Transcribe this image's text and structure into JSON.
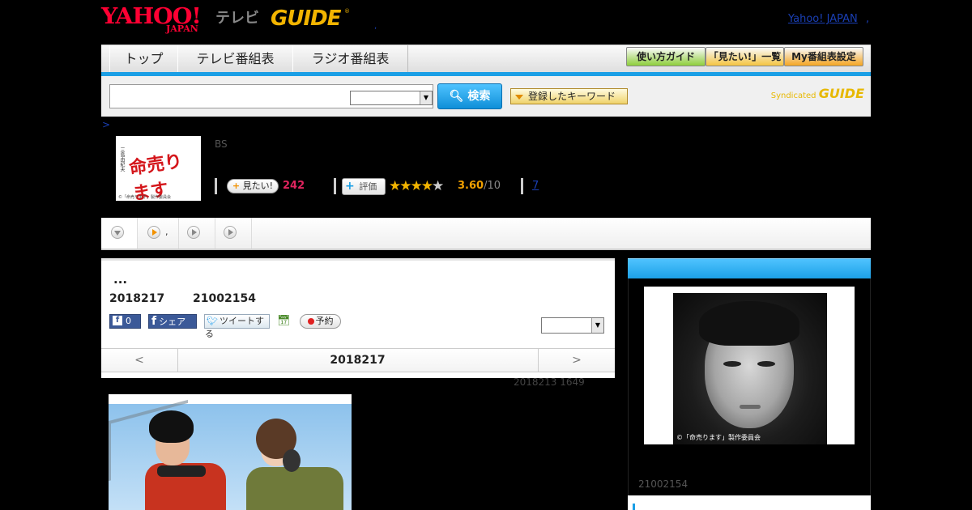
{
  "header": {
    "logo_yahoo": "YAHOO!",
    "logo_japan": "JAPAN",
    "logo_tv": "テレビ",
    "logo_gguide": "GUIDE",
    "logo_reg": "®",
    "dot": ",",
    "yahoo_japan_link": "Yahoo! JAPAN",
    "yahoo_japan_dot": ","
  },
  "nav": {
    "tabs": [
      "トップ",
      "テレビ番組表",
      "ラジオ番組表"
    ],
    "buttons": [
      "使い方ガイド",
      "「見たい!」一覧",
      "My番組表設定"
    ],
    "button_colors": [
      "#8fcf3c",
      "#f5c542",
      "#f5a623"
    ]
  },
  "search": {
    "input_value": "",
    "select_value": "",
    "button_label": "検索",
    "keyword_button": "登録したキーワード",
    "syndicated": "Syndicated",
    "syndicated_logo": "GUIDE"
  },
  "breadcrumb": ">",
  "program": {
    "thumb_title": "命売ります",
    "thumb_side": "三島由紀夫",
    "thumb_copyright": "©「命売ります」製作委員会",
    "channel": "BS",
    "mitai_label": "見たい!",
    "mitai_count": "242",
    "hyoka_label": "評価",
    "rating": 3.6,
    "score": "3.60",
    "score_den": "/10",
    "review_count": "7"
  },
  "subtabs": [
    {
      "icon": "down-arrow-icon",
      "label": ""
    },
    {
      "icon": "play-orange-icon",
      "label": ","
    },
    {
      "icon": "play-gray-icon",
      "label": ""
    },
    {
      "icon": "play-gray-icon",
      "label": ""
    }
  ],
  "episode": {
    "title": "...",
    "date": "2018217",
    "code": "21002154",
    "fb_count": "0",
    "fb_share": "シェア",
    "tweet": "ツイートする",
    "reserve": "予約",
    "select_value": "",
    "nav_prev": "<",
    "nav_current": "2018217",
    "nav_next": ">"
  },
  "updated": "2018213  1649",
  "right": {
    "photo_copyright": "©「命売ります」製作委員会",
    "code": "21002154"
  }
}
